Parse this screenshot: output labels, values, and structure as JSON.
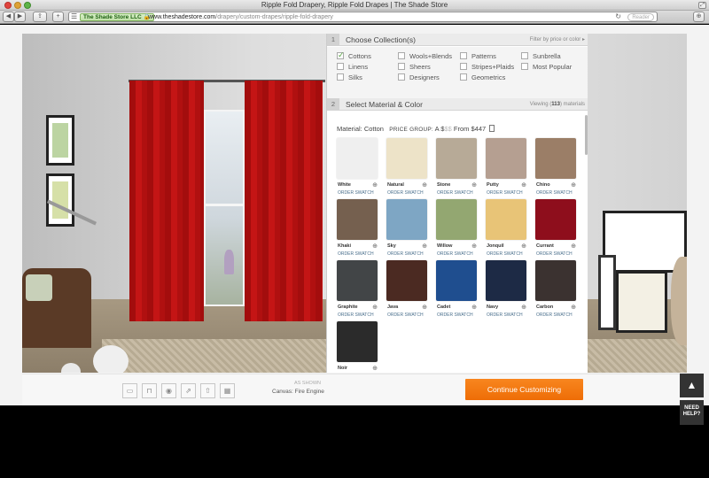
{
  "window": {
    "title": "Ripple Fold Drapery, Ripple Fold Drapes | The Shade Store",
    "fullscreen_glyph": "⤢"
  },
  "toolbar": {
    "back": "◀",
    "forward": "▶",
    "share": "⇪",
    "add": "+",
    "sidebar": "☰",
    "cert_label": "The Shade Store LLC 🔒",
    "url_host": "www.theshadestore.com",
    "url_path": "/drapery/custom-drapes/ripple-fold-drapery",
    "reload": "↻",
    "reader": "Reader",
    "downloads": "⊕"
  },
  "collections": {
    "number": "1",
    "title": "Choose Collection(s)",
    "filter_label": "Filter by price or color ▸",
    "items": [
      {
        "label": "Cottons",
        "checked": true
      },
      {
        "label": "Linens",
        "checked": false
      },
      {
        "label": "Silks",
        "checked": false
      },
      {
        "label": "Wools+Blends",
        "checked": false
      },
      {
        "label": "Sheers",
        "checked": false
      },
      {
        "label": "Designers",
        "checked": false
      },
      {
        "label": "Patterns",
        "checked": false
      },
      {
        "label": "Stripes+Plaids",
        "checked": false
      },
      {
        "label": "Geometrics",
        "checked": false
      },
      {
        "label": "Sunbrella",
        "checked": false
      },
      {
        "label": "Most Popular",
        "checked": false
      }
    ]
  },
  "materials": {
    "number": "2",
    "title": "Select Material & Color",
    "viewing_prefix": "Viewing (",
    "viewing_count": "113",
    "viewing_suffix": ") materials",
    "material_label": "Material: Cotton",
    "price_group_label": "PRICE GROUP:",
    "price_tier_active": "A $",
    "price_tier_dim": "$$",
    "price_from": "From $447",
    "order_swatch_label": "ORDER SWATCH",
    "zoom_glyph": "⊕",
    "swatches": [
      {
        "name": "White",
        "color": "#efefef"
      },
      {
        "name": "Natural",
        "color": "#ede3c8"
      },
      {
        "name": "Stone",
        "color": "#b7aa97"
      },
      {
        "name": "Putty",
        "color": "#b59f91"
      },
      {
        "name": "Chino",
        "color": "#9b7e67"
      },
      {
        "name": "Khaki",
        "color": "#75604f"
      },
      {
        "name": "Sky",
        "color": "#7ea6c4"
      },
      {
        "name": "Willow",
        "color": "#93a771"
      },
      {
        "name": "Jonquil",
        "color": "#e8c477"
      },
      {
        "name": "Currant",
        "color": "#8e0e1c"
      },
      {
        "name": "Graphite",
        "color": "#424547"
      },
      {
        "name": "Java",
        "color": "#4b2a22"
      },
      {
        "name": "Cadet",
        "color": "#1f4e8f"
      },
      {
        "name": "Navy",
        "color": "#1d2a45"
      },
      {
        "name": "Carbon",
        "color": "#3b3230"
      },
      {
        "name": "Noir",
        "color": "#2b2b2b"
      }
    ]
  },
  "bottom_bar": {
    "tools": [
      "▭",
      "⊓",
      "◉",
      "⇗",
      "⇧",
      "▦"
    ],
    "as_shown": "AS SHOWN",
    "canvas_label": "Canvas: Fire Engine",
    "cta_label": "Continue Customizing"
  },
  "side_widgets": {
    "scroll_top": "▲",
    "help_line1": "NEED",
    "help_line2": "HELP?"
  },
  "colors": {
    "accent": "#f07a12",
    "curtain": "#b81212"
  }
}
